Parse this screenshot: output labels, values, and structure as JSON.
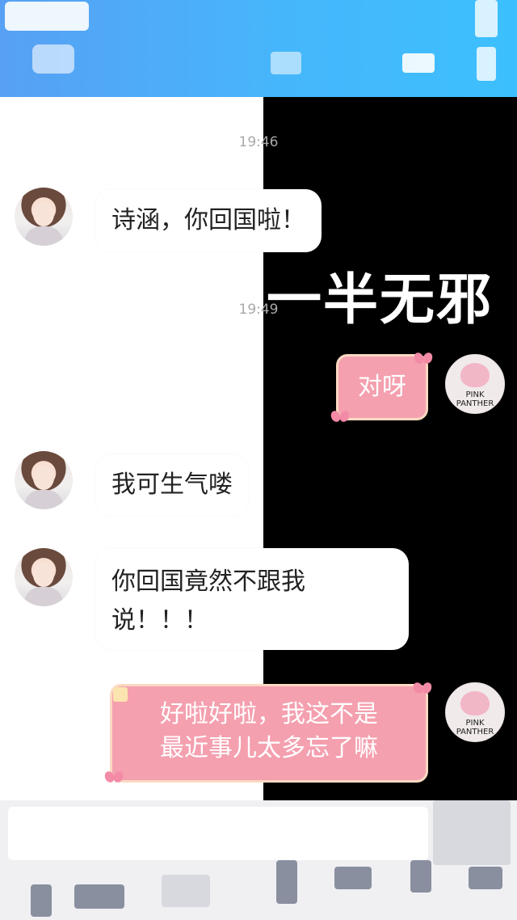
{
  "header": {
    "decor": "puzzle-pattern",
    "colors": {
      "start": "#57a0f4",
      "end": "#3cc0fd"
    }
  },
  "background": {
    "watermark_text": "一半无邪",
    "colors": {
      "left": "#ffffff",
      "right": "#000000"
    }
  },
  "chat": {
    "timestamps": [
      "19:46",
      "19:49"
    ],
    "messages": [
      {
        "side": "left",
        "avatar": "girl-avatar",
        "lines": [
          "诗涵，你回国啦！"
        ]
      },
      {
        "side": "right",
        "avatar": "pink-panther-avatar",
        "lines": [
          "对呀"
        ],
        "style": "pink-sticker"
      },
      {
        "side": "left",
        "avatar": "girl-avatar",
        "lines": [
          "我可生气喽"
        ]
      },
      {
        "side": "left",
        "avatar": "girl-avatar",
        "lines": [
          "你回国竟然不跟我",
          "说！！！"
        ]
      },
      {
        "side": "right",
        "avatar": "pink-panther-avatar",
        "lines": [
          "好啦好啦，我这不是",
          "最近事儿太多忘了嘛"
        ],
        "style": "pink-sticker"
      }
    ],
    "panther_label": [
      "PINK",
      "PANTHER"
    ],
    "colors": {
      "pink_bubble": "#f4a0af",
      "timestamp": "#a8a8a8"
    }
  },
  "input": {
    "value": "",
    "decor": "puzzle-pattern"
  }
}
